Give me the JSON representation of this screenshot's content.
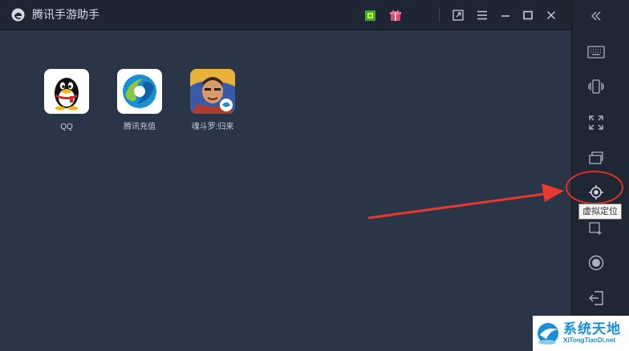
{
  "titlebar": {
    "app_title": "腾讯手游助手",
    "icons": [
      "logo-icon",
      "green-chip-icon",
      "gift-icon",
      "popout-icon",
      "menu-icon",
      "minimize-icon",
      "maximize-icon",
      "close-icon"
    ]
  },
  "apps": [
    {
      "label": "QQ",
      "icon": "qq-penguin-icon"
    },
    {
      "label": "腾讯充值",
      "icon": "tencent-recharge-icon"
    },
    {
      "label": "魂斗罗:归来",
      "icon": "contra-returns-icon"
    }
  ],
  "sidebar": {
    "buttons": [
      "collapse",
      "keyboard",
      "shake",
      "fullscreen",
      "multi-window",
      "virtual-location",
      "screenshot",
      "record",
      "exit"
    ],
    "tooltip": "虚拟定位"
  },
  "annotation": {
    "ring_color": "#e03127",
    "arrow_color": "#e8392f"
  },
  "watermark": {
    "brand": "系统天地",
    "url": "XiTongTianDi.net"
  },
  "colors": {
    "background": "#2b3548",
    "titlebar": "#1e2533",
    "sidebar": "#202734"
  }
}
